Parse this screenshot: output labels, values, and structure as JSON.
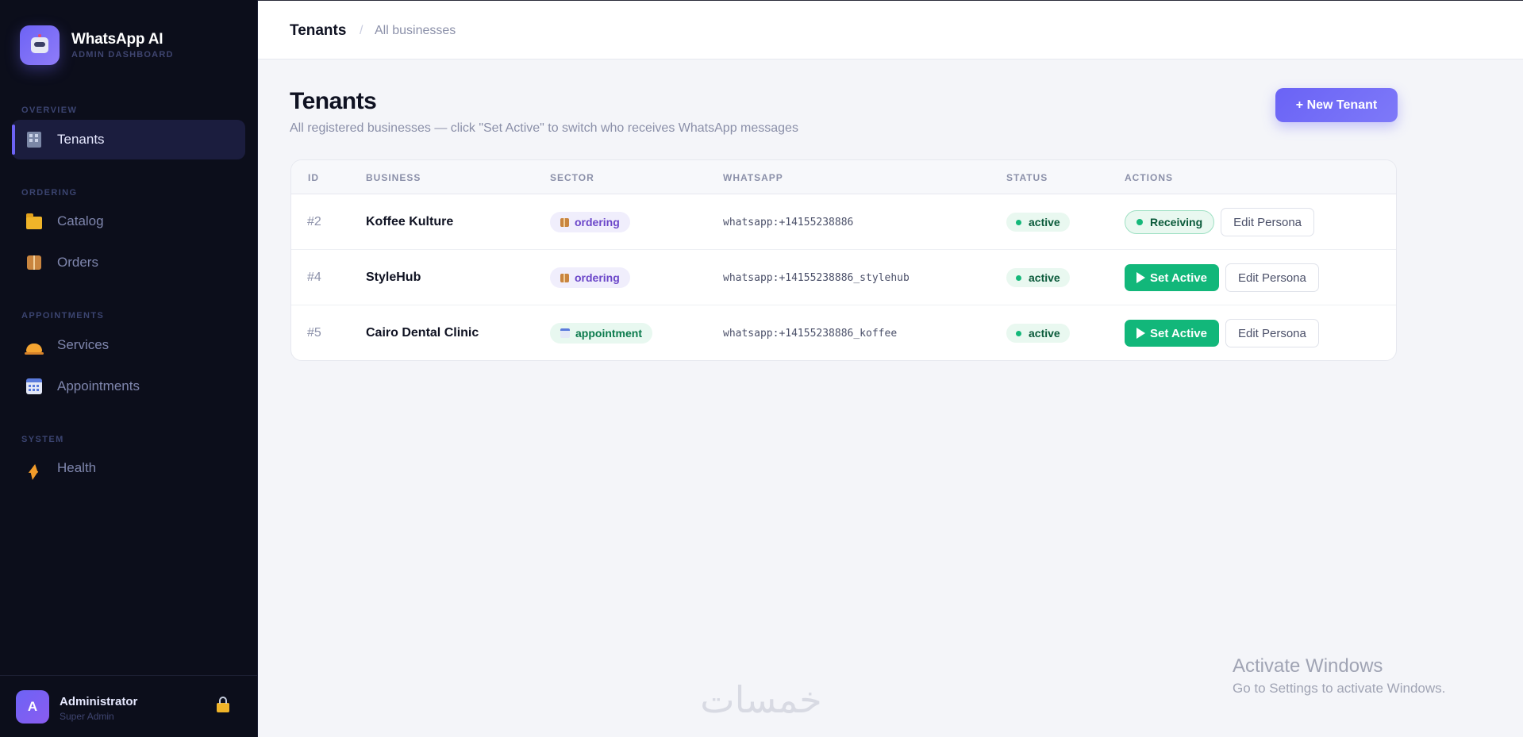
{
  "brand": {
    "name": "WhatsApp AI",
    "subtitle": "ADMIN DASHBOARD"
  },
  "sidebar": {
    "sections": [
      {
        "label": "OVERVIEW",
        "items": [
          {
            "label": "Tenants",
            "icon": "building-icon",
            "active": true
          }
        ]
      },
      {
        "label": "ORDERING",
        "items": [
          {
            "label": "Catalog",
            "icon": "folder-icon"
          },
          {
            "label": "Orders",
            "icon": "package-icon"
          }
        ]
      },
      {
        "label": "APPOINTMENTS",
        "items": [
          {
            "label": "Services",
            "icon": "bell-icon"
          },
          {
            "label": "Appointments",
            "icon": "calendar-icon"
          }
        ]
      },
      {
        "label": "SYSTEM",
        "items": [
          {
            "label": "Health",
            "icon": "lightning-icon"
          }
        ]
      }
    ],
    "user": {
      "initial": "A",
      "name": "Administrator",
      "role": "Super Admin"
    }
  },
  "topbar": {
    "title": "Tenants",
    "separator": "/",
    "subtitle": "All businesses"
  },
  "main": {
    "title": "Tenants",
    "subtitle": "All registered businesses — click \"Set Active\" to switch who receives WhatsApp messages",
    "new_button": "+ New Tenant",
    "table": {
      "headers": [
        "ID",
        "BUSINESS",
        "SECTOR",
        "WHATSAPP",
        "STATUS",
        "ACTIONS"
      ],
      "rows": [
        {
          "id": "#2",
          "business": "Koffee Kulture",
          "sector": "ordering",
          "whatsapp": "whatsapp:+14155238886",
          "status": "active",
          "primary_action": "Receiving",
          "secondary_action": "Edit Persona"
        },
        {
          "id": "#4",
          "business": "StyleHub",
          "sector": "ordering",
          "whatsapp": "whatsapp:+14155238886_stylehub",
          "status": "active",
          "primary_action": "Set Active",
          "secondary_action": "Edit Persona"
        },
        {
          "id": "#5",
          "business": "Cairo Dental Clinic",
          "sector": "appointment",
          "whatsapp": "whatsapp:+14155238886_koffee",
          "status": "active",
          "primary_action": "Set Active",
          "secondary_action": "Edit Persona"
        }
      ]
    }
  },
  "overlay": {
    "activate_title": "Activate Windows",
    "activate_sub": "Go to Settings to activate Windows.",
    "watermark_text": "خمسات"
  },
  "colors": {
    "accent": "#6d63f5",
    "success": "#12b77a",
    "sidebar_bg": "#0c0e1b",
    "page_bg": "#f4f5f9"
  }
}
